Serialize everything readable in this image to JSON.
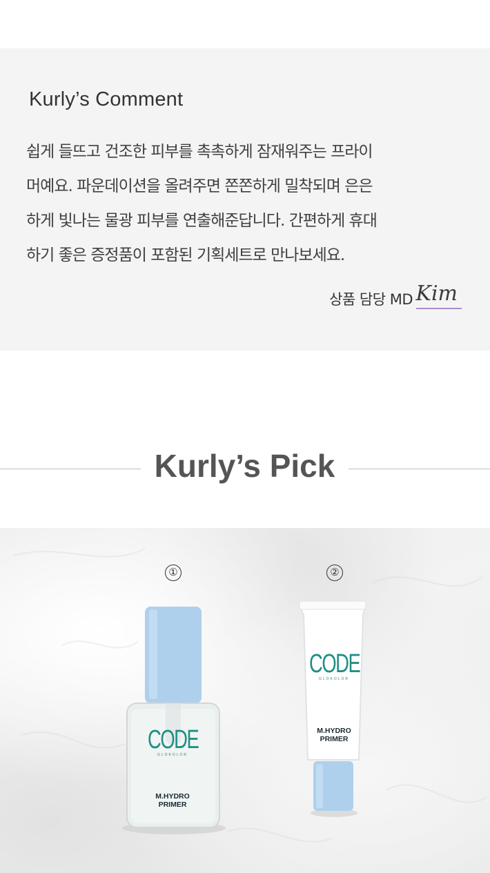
{
  "comment": {
    "title": "Kurly’s Comment",
    "lines": [
      "쉽게 들뜨고 건조한 피부를 촉촉하게 잠재워주는 프라이",
      "머예요. 파운데이션을 올려주면 쫀쫀하게 밀착되며 은은",
      "하게 빛나는 물광 피부를 연출해준답니다. 간편하게 휴대",
      "하기 좋은 증정품이 포함된 기획세트로 만나보세요."
    ],
    "signature_label": "상품 담당 MD",
    "signature_name": "Kim",
    "signature_underline_color": "#a98ccf"
  },
  "pick": {
    "title": "Kurly’s Pick"
  },
  "products": [
    {
      "number": "①",
      "brand": "CODE",
      "brand_sub": "GLOKOLOR",
      "name_line1": "M.HYDRO",
      "name_line2": "PRIMER",
      "accent_color": "#aed0ec"
    },
    {
      "number": "②",
      "brand": "CODE",
      "brand_sub": "GLOKOLOR",
      "name_line1": "M.HYDRO",
      "name_line2": "PRIMER",
      "accent_color": "#aed0ec"
    }
  ]
}
